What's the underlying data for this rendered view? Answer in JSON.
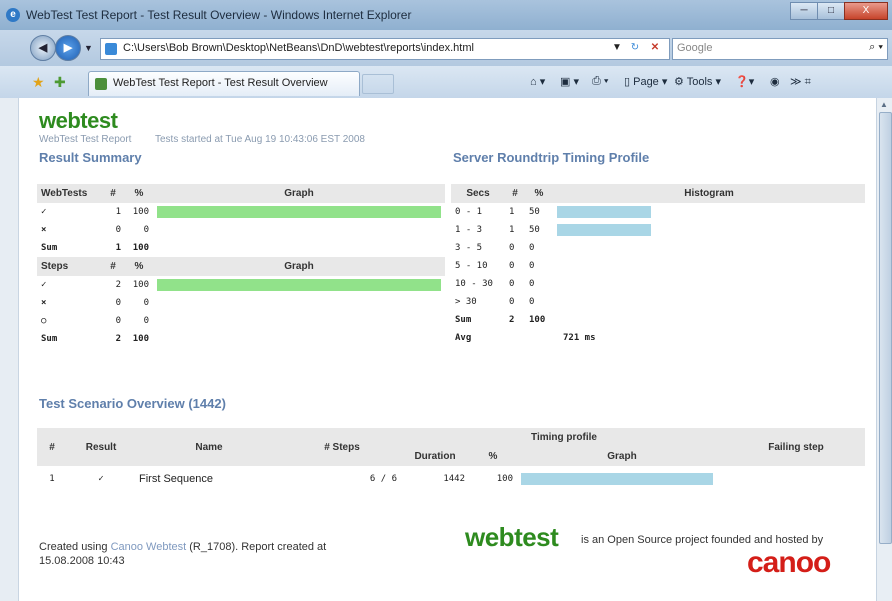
{
  "window": {
    "title": "WebTest Test Report - Test Result Overview - Windows Internet Explorer",
    "min": "─",
    "max": "□",
    "close": "X"
  },
  "addressbar": {
    "url": "C:\\Users\\Bob Brown\\Desktop\\NetBeans\\DnD\\webtest\\reports\\index.html",
    "search_placeholder": "Google"
  },
  "tab": {
    "label": "WebTest Test Report - Test Result Overview"
  },
  "commands": {
    "page": "Page",
    "tools": "Tools"
  },
  "report": {
    "logo": "webtest",
    "subtitle_left": "WebTest Test Report",
    "subtitle_right": "Tests started at Tue Aug 19 10:43:06 EST 2008",
    "result_summary": "Result Summary",
    "timing_profile": "Server Roundtrip Timing Profile",
    "tests_table": {
      "headers": [
        "WebTests",
        "#",
        "%",
        "Graph"
      ],
      "rows": [
        {
          "icon": "✓",
          "count": "1",
          "pct": "100",
          "fill": 1.0
        },
        {
          "icon": "×",
          "count": "0",
          "pct": "0",
          "fill": 0
        }
      ],
      "sum": {
        "label": "Sum",
        "count": "1",
        "pct": "100"
      }
    },
    "steps_table": {
      "headers": [
        "Steps",
        "#",
        "%",
        "Graph"
      ],
      "rows": [
        {
          "icon": "✓",
          "count": "2",
          "pct": "100",
          "fill": 1.0
        },
        {
          "icon": "×",
          "count": "0",
          "pct": "0",
          "fill": 0
        },
        {
          "icon": "○",
          "count": "0",
          "pct": "0",
          "fill": 0
        }
      ],
      "sum": {
        "label": "Sum",
        "count": "2",
        "pct": "100"
      }
    },
    "histogram": {
      "headers": [
        "Secs",
        "#",
        "%",
        "Histogram"
      ],
      "rows": [
        {
          "range": "0 - 1",
          "count": "1",
          "pct": "50",
          "fill": 0.5
        },
        {
          "range": "1 - 3",
          "count": "1",
          "pct": "50",
          "fill": 0.5
        },
        {
          "range": "3 - 5",
          "count": "0",
          "pct": "0",
          "fill": 0
        },
        {
          "range": "5 - 10",
          "count": "0",
          "pct": "0",
          "fill": 0
        },
        {
          "range": "10 - 30",
          "count": "0",
          "pct": "0",
          "fill": 0
        },
        {
          "range": "> 30",
          "count": "0",
          "pct": "0",
          "fill": 0
        }
      ],
      "sum": {
        "label": "Sum",
        "count": "2",
        "pct": "100"
      },
      "avg": {
        "label": "Avg",
        "value": "721 ms"
      }
    },
    "scenario": {
      "title": "Test Scenario Overview (1442)",
      "headers": {
        "num": "#",
        "result": "Result",
        "name": "Name",
        "steps": "# Steps",
        "timing": "Timing profile",
        "duration": "Duration",
        "pct": "%",
        "graph": "Graph",
        "failing": "Failing step"
      },
      "rows": [
        {
          "num": "1",
          "result": "✓",
          "name": "First Sequence",
          "steps": "6 / 6",
          "duration": "1442",
          "pct": "100",
          "fill": 1.0,
          "failing": ""
        }
      ]
    },
    "footer": {
      "created_prefix": "Created using",
      "created_link": "Canoo Webtest",
      "created_suffix": "(R_1708). Report created at",
      "created_date": "15.08.2008 10:43",
      "oss_text": "is an Open Source project founded and hosted by",
      "logo": "webtest",
      "canoo": "canoo"
    }
  }
}
